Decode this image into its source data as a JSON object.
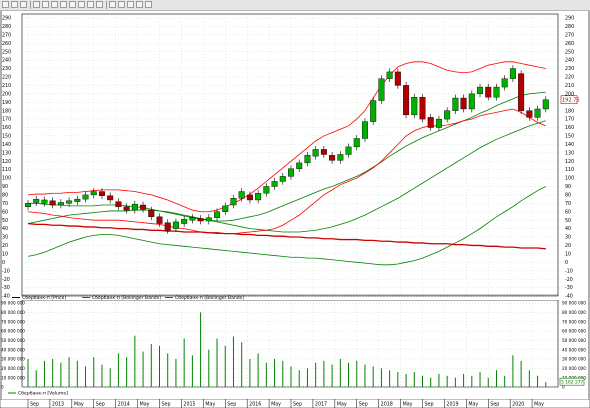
{
  "toolbar": {
    "buttons": [
      "arrow-icon",
      "pencil-icon",
      "refresh-icon",
      "add-icon",
      "window-icon",
      "window-icon",
      "window-icon",
      "save-icon",
      "window-icon",
      "chart-icon",
      "window-icon",
      "text-tool-icon",
      "cursor-icon",
      "line-tool-icon",
      "line-tool-icon",
      "line-tool-icon"
    ]
  },
  "price_panel": {
    "y_ticks": [
      290,
      280,
      270,
      260,
      250,
      240,
      230,
      220,
      210,
      200,
      190,
      180,
      170,
      160,
      150,
      140,
      130,
      120,
      110,
      100,
      90,
      80,
      70,
      60,
      50,
      40,
      30,
      20,
      10,
      0,
      -10,
      -20,
      -30,
      -40
    ],
    "last_price_label": "192.75",
    "legend": [
      {
        "label": "Сбербанк-п [Price]",
        "color": "#000000"
      },
      {
        "label": "Сбербанк-п [Bollinger Bands]",
        "color": "#008000"
      },
      {
        "label": "Сбербанк-п [Bollinger Bands]",
        "color": "#ff0000"
      }
    ]
  },
  "volume_panel": {
    "y_ticks": [
      "90 000 000",
      "80 000 000",
      "70 000 000",
      "60 000 000",
      "50 000 000",
      "40 000 000",
      "30 000 000",
      "20 000 000",
      "10 000 000",
      "0"
    ],
    "last_volume_label": "5 162 277",
    "legend": [
      {
        "label": "Сбербанк-п [Volume]",
        "color": "#008000"
      }
    ]
  },
  "timeline": {
    "labels": [
      "Sep",
      "2013",
      "May",
      "Sep",
      "2014",
      "May",
      "Sep",
      "2015",
      "May",
      "Sep",
      "2016",
      "May",
      "Sep",
      "2017",
      "May",
      "Sep",
      "2018",
      "May",
      "Sep",
      "2019",
      "May",
      "Sep",
      "2020",
      "May"
    ]
  },
  "chart_data": [
    {
      "type": "candlestick",
      "title": "",
      "ylim": [
        -40,
        290
      ],
      "series": [
        {
          "name": "Сбербанк-п [Price]",
          "color": "#000000",
          "candles": [
            {
              "o": 66,
              "c": 70
            },
            {
              "o": 71,
              "c": 75
            },
            {
              "o": 70,
              "c": 74
            },
            {
              "o": 73,
              "c": 68
            },
            {
              "o": 68,
              "c": 71
            },
            {
              "o": 70,
              "c": 73
            },
            {
              "o": 72,
              "c": 75
            },
            {
              "o": 75,
              "c": 80
            },
            {
              "o": 80,
              "c": 84
            },
            {
              "o": 84,
              "c": 79
            },
            {
              "o": 79,
              "c": 74
            },
            {
              "o": 72,
              "c": 66
            },
            {
              "o": 66,
              "c": 62
            },
            {
              "o": 62,
              "c": 69
            },
            {
              "o": 68,
              "c": 63
            },
            {
              "o": 62,
              "c": 54
            },
            {
              "o": 54,
              "c": 46
            },
            {
              "o": 47,
              "c": 38
            },
            {
              "o": 40,
              "c": 48
            },
            {
              "o": 46,
              "c": 51
            },
            {
              "o": 50,
              "c": 53
            },
            {
              "o": 52,
              "c": 49
            },
            {
              "o": 49,
              "c": 53
            },
            {
              "o": 53,
              "c": 60
            },
            {
              "o": 60,
              "c": 67
            },
            {
              "o": 68,
              "c": 76
            },
            {
              "o": 76,
              "c": 84
            },
            {
              "o": 80,
              "c": 74
            },
            {
              "o": 74,
              "c": 82
            },
            {
              "o": 82,
              "c": 90
            },
            {
              "o": 90,
              "c": 96
            },
            {
              "o": 96,
              "c": 102
            },
            {
              "o": 102,
              "c": 111
            },
            {
              "o": 111,
              "c": 118
            },
            {
              "o": 118,
              "c": 127
            },
            {
              "o": 126,
              "c": 134
            },
            {
              "o": 134,
              "c": 128
            },
            {
              "o": 127,
              "c": 121
            },
            {
              "o": 121,
              "c": 128
            },
            {
              "o": 128,
              "c": 137
            },
            {
              "o": 137,
              "c": 147
            },
            {
              "o": 147,
              "c": 167
            },
            {
              "o": 167,
              "c": 192
            },
            {
              "o": 192,
              "c": 218
            },
            {
              "o": 218,
              "c": 226
            },
            {
              "o": 226,
              "c": 210
            },
            {
              "o": 210,
              "c": 175
            },
            {
              "o": 175,
              "c": 196
            },
            {
              "o": 196,
              "c": 170
            },
            {
              "o": 172,
              "c": 160
            },
            {
              "o": 160,
              "c": 170
            },
            {
              "o": 170,
              "c": 180
            },
            {
              "o": 180,
              "c": 195
            },
            {
              "o": 195,
              "c": 182
            },
            {
              "o": 182,
              "c": 200
            },
            {
              "o": 200,
              "c": 208
            },
            {
              "o": 208,
              "c": 196
            },
            {
              "o": 196,
              "c": 208
            },
            {
              "o": 208,
              "c": 218
            },
            {
              "o": 218,
              "c": 230
            },
            {
              "o": 224,
              "c": 180
            },
            {
              "o": 180,
              "c": 172
            },
            {
              "o": 172,
              "c": 182
            },
            {
              "o": 182,
              "c": 193
            }
          ]
        },
        {
          "name": "Сбербанк-п [Bollinger Bands]",
          "color": "#008000",
          "role": "middle",
          "values": [
            70,
            70,
            69,
            68,
            68,
            67,
            67,
            67,
            67,
            68,
            68,
            68,
            67,
            66,
            65,
            63,
            61,
            59,
            57,
            55,
            53,
            51,
            50,
            49,
            49,
            50,
            52,
            54,
            56,
            59,
            63,
            67,
            71,
            75,
            79,
            83,
            87,
            90,
            94,
            98,
            102,
            107,
            113,
            119,
            126,
            132,
            138,
            143,
            148,
            152,
            156,
            160,
            164,
            168,
            172,
            177,
            181,
            186,
            190,
            194,
            198,
            200,
            201,
            202
          ]
        },
        {
          "name": "Сбербанк-п [Bollinger Bands]",
          "color": "#008000",
          "role": "long-term",
          "values": [
            46,
            48,
            50,
            52,
            54,
            56,
            57,
            58,
            59,
            60,
            61,
            61,
            61,
            62,
            62,
            62,
            61,
            60,
            58,
            56,
            54,
            52,
            50,
            48,
            46,
            44,
            42,
            40,
            39,
            38,
            37,
            36,
            36,
            36,
            37,
            38,
            40,
            42,
            45,
            48,
            52,
            56,
            61,
            66,
            71,
            76,
            82,
            88,
            94,
            100,
            106,
            112,
            118,
            124,
            130,
            136,
            141,
            146,
            150,
            154,
            158,
            162,
            165,
            168
          ]
        },
        {
          "name": "Сбербанк-п [Bollinger Bands]",
          "color": "#008000",
          "role": "oscillator",
          "values": [
            7,
            9,
            12,
            16,
            20,
            24,
            27,
            30,
            32,
            33,
            33,
            32,
            30,
            28,
            26,
            24,
            22,
            21,
            20,
            19,
            18,
            17,
            16,
            15,
            14,
            13,
            12,
            11,
            10,
            9,
            8,
            7,
            6,
            6,
            5,
            5,
            4,
            3,
            2,
            1,
            0,
            -1,
            -2,
            -3,
            -3,
            -2,
            0,
            2,
            5,
            9,
            13,
            18,
            23,
            28,
            34,
            40,
            47,
            54,
            60,
            66,
            73,
            79,
            85,
            90
          ]
        },
        {
          "name": "Сбербанк-п [Bollinger Bands]",
          "color": "#ff0000",
          "role": "upper",
          "values": [
            80,
            81,
            81,
            82,
            82,
            83,
            83,
            84,
            85,
            86,
            86,
            86,
            85,
            84,
            82,
            80,
            77,
            74,
            70,
            66,
            62,
            60,
            60,
            62,
            66,
            70,
            75,
            81,
            88,
            96,
            104,
            112,
            120,
            128,
            136,
            144,
            150,
            154,
            158,
            162,
            170,
            180,
            195,
            210,
            222,
            232,
            236,
            238,
            238,
            236,
            232,
            228,
            226,
            225,
            226,
            230,
            234,
            236,
            238,
            238,
            236,
            234,
            232,
            230
          ]
        },
        {
          "name": "Сбербанк-п [Bollinger Bands]",
          "color": "#ff0000",
          "role": "lower",
          "values": [
            60,
            59,
            58,
            56,
            55,
            53,
            52,
            51,
            50,
            50,
            50,
            50,
            49,
            48,
            47,
            46,
            45,
            43,
            41,
            40,
            38,
            36,
            35,
            34,
            34,
            34,
            35,
            36,
            37,
            38,
            40,
            44,
            50,
            56,
            64,
            72,
            80,
            86,
            92,
            96,
            100,
            106,
            112,
            120,
            130,
            140,
            150,
            156,
            160,
            162,
            162,
            163,
            165,
            168,
            170,
            174,
            176,
            178,
            180,
            182,
            178,
            172,
            166,
            162
          ]
        },
        {
          "name": "Сбербанк-п [Bollinger Bands]",
          "color": "#cc0000",
          "role": "trend",
          "values": [
            46,
            45,
            45,
            44,
            44,
            43,
            43,
            42,
            42,
            41,
            41,
            40,
            40,
            39,
            39,
            38,
            38,
            37,
            37,
            36,
            36,
            36,
            35,
            35,
            34,
            34,
            33,
            33,
            32,
            32,
            31,
            31,
            30,
            30,
            29,
            29,
            28,
            28,
            27,
            27,
            27,
            26,
            26,
            25,
            25,
            24,
            24,
            23,
            23,
            22,
            22,
            22,
            21,
            21,
            20,
            20,
            19,
            19,
            18,
            18,
            17,
            17,
            17,
            16
          ]
        }
      ]
    },
    {
      "type": "bar",
      "title": "",
      "ylim": [
        0,
        90000000
      ],
      "series": [
        {
          "name": "Сбербанк-п [Volume]",
          "color": "#008000",
          "values": [
            30000000,
            18000000,
            28000000,
            30000000,
            26000000,
            32000000,
            28000000,
            22000000,
            32000000,
            24000000,
            20000000,
            36000000,
            32000000,
            55000000,
            38000000,
            46000000,
            44000000,
            36000000,
            30000000,
            52000000,
            34000000,
            80000000,
            40000000,
            52000000,
            44000000,
            54000000,
            48000000,
            30000000,
            36000000,
            26000000,
            30000000,
            28000000,
            22000000,
            18000000,
            20000000,
            26000000,
            28000000,
            24000000,
            30000000,
            26000000,
            28000000,
            24000000,
            22000000,
            20000000,
            18000000,
            16000000,
            14000000,
            16000000,
            12000000,
            10000000,
            14000000,
            12000000,
            10000000,
            14000000,
            12000000,
            16000000,
            10000000,
            18000000,
            12000000,
            34000000,
            28000000,
            18000000,
            12000000,
            5162277
          ]
        }
      ]
    }
  ]
}
